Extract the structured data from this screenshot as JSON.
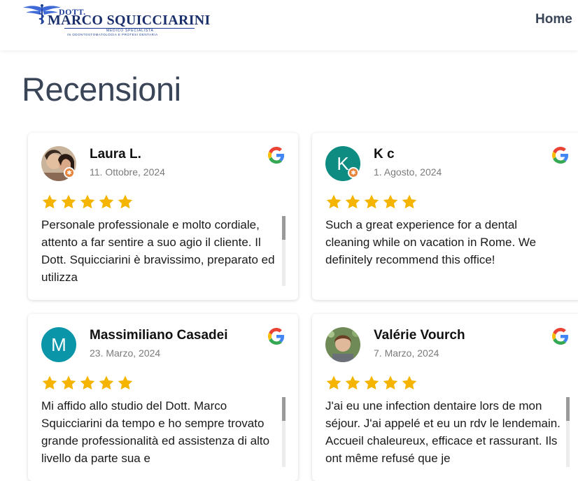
{
  "header": {
    "logo": {
      "dott": "DOTT.",
      "name": "MARCO SQUICCIARINI",
      "line1": "MEDICO SPECIALISTA",
      "line2": "IN ODONTOSTOMATOLOGIA E PROTESI DENTARIA"
    },
    "nav": {
      "home": "Home"
    }
  },
  "page": {
    "title": "Recensioni"
  },
  "colors": {
    "title": "#3a4558",
    "star": "#f4b400",
    "avatar_kc": "#0e8c82",
    "avatar_m": "#0a95a8",
    "badge": "#e8833a"
  },
  "reviews": [
    {
      "name": "Laura L.",
      "date": "11. Ottobre, 2024",
      "rating": 5,
      "avatar_type": "photo",
      "text": "Personale professionale e molto cordiale, attento a far sentire a suo agio il cliente. Il Dott. Squicciarini è bravissimo, preparato ed utilizza",
      "scrollable": true
    },
    {
      "name": "K c",
      "date": "1. Agosto, 2024",
      "rating": 5,
      "avatar_type": "letter",
      "avatar_letter": "K",
      "text": "Such a great experience for a dental cleaning while on vacation in Rome. We definitely recommend this office!",
      "scrollable": false
    },
    {
      "name": "Massimiliano Casadei",
      "date": "23. Marzo, 2024",
      "rating": 5,
      "avatar_type": "letter",
      "avatar_letter": "M",
      "text": "Mi affido allo studio del Dott. Marco Squicciarini da tempo e ho sempre trovato grande professionalità ed assistenza di alto livello da parte sua e",
      "scrollable": true
    },
    {
      "name": "Valérie Vourch",
      "date": "7. Marzo, 2024",
      "rating": 5,
      "avatar_type": "photo",
      "text": "J'ai eu une infection dentaire lors de mon séjour. J'ai appelé et eu un rdv le lendemain. Accueil chaleureux, efficace et rassurant. Ils ont même refusé que je",
      "scrollable": true
    }
  ]
}
